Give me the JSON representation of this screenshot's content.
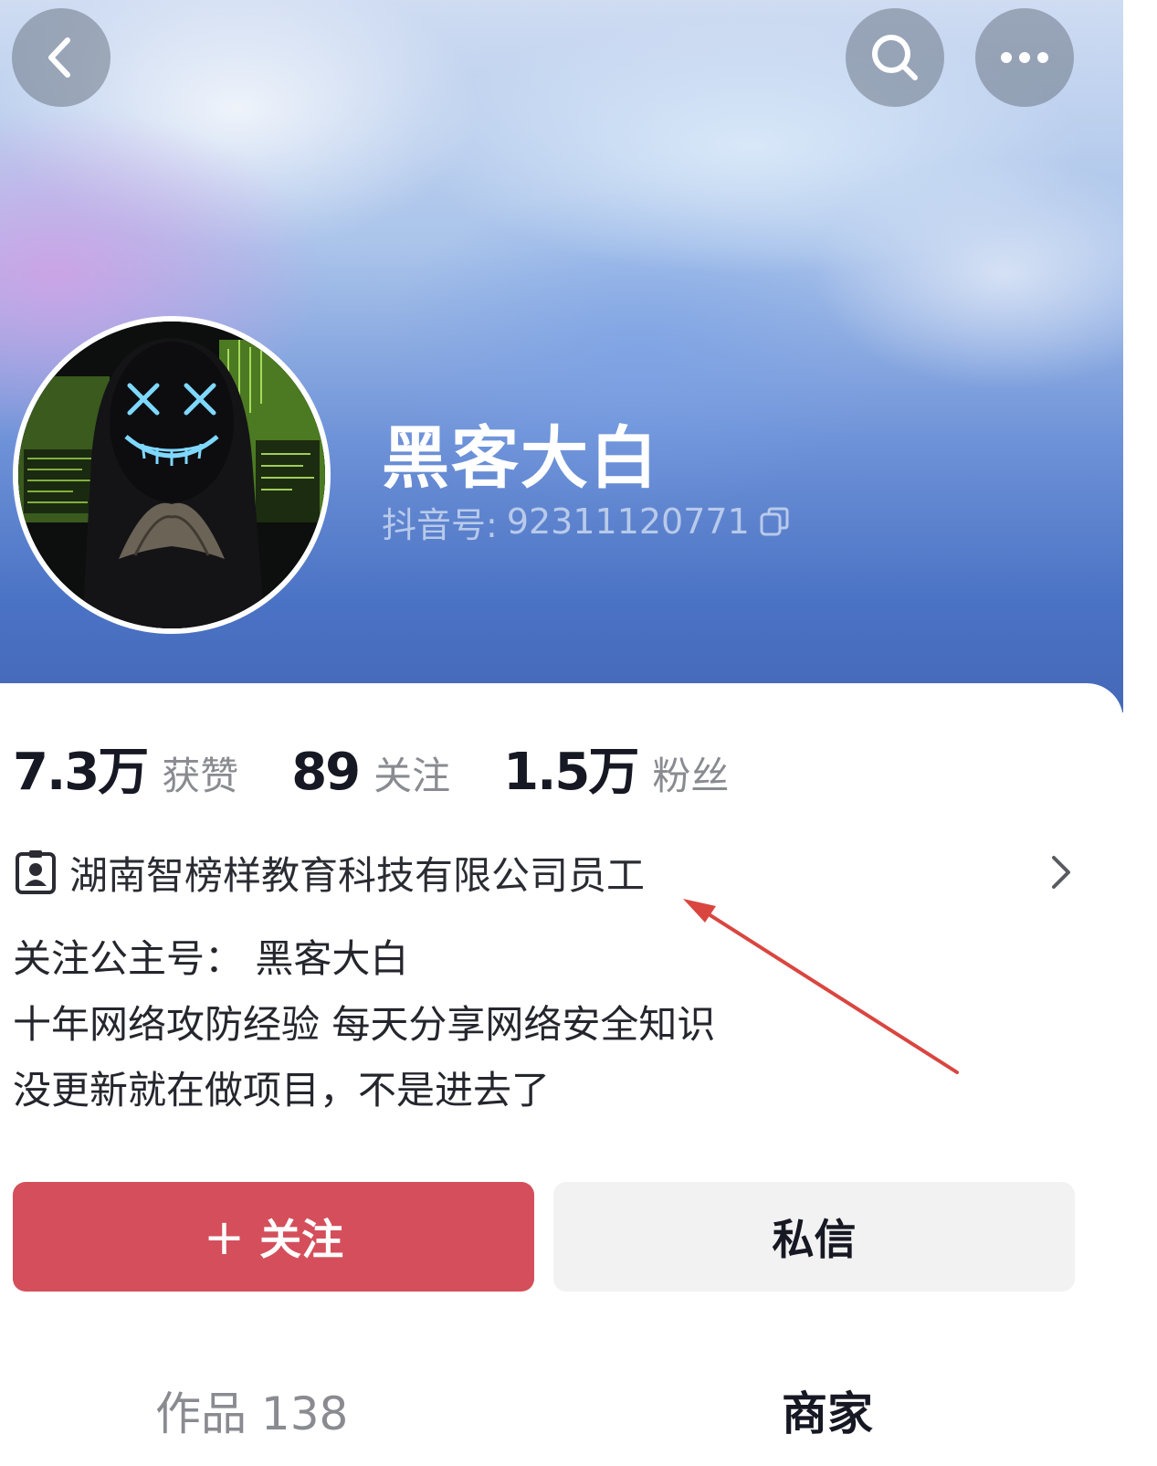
{
  "header": {
    "nickname": "黑客大白",
    "douyin_id_label": "抖音号:",
    "douyin_id": "92311120771",
    "icons": [
      "back-icon",
      "search-icon",
      "more-icon",
      "copy-icon"
    ]
  },
  "stats": [
    {
      "value": "7.3万",
      "label": "获赞"
    },
    {
      "value": "89",
      "label": "关注"
    },
    {
      "value": "1.5万",
      "label": "粉丝"
    }
  ],
  "employer": {
    "text": "湖南智榜样教育科技有限公司员工",
    "icon": "id-badge-icon"
  },
  "bio": [
    "关注公主号：   黑客大白",
    "十年网络攻防经验 每天分享网络安全知识",
    "没更新就在做项目，不是进去了"
  ],
  "actions": {
    "follow_plus": "+",
    "follow_label": "关注",
    "message_label": "私信"
  },
  "tabs": {
    "works": "作品 138",
    "merchant": "商家"
  },
  "colors": {
    "follow_button": "#d44f5b",
    "annotation_arrow": "#d9463f",
    "banner_blue": "#4a72c4"
  }
}
